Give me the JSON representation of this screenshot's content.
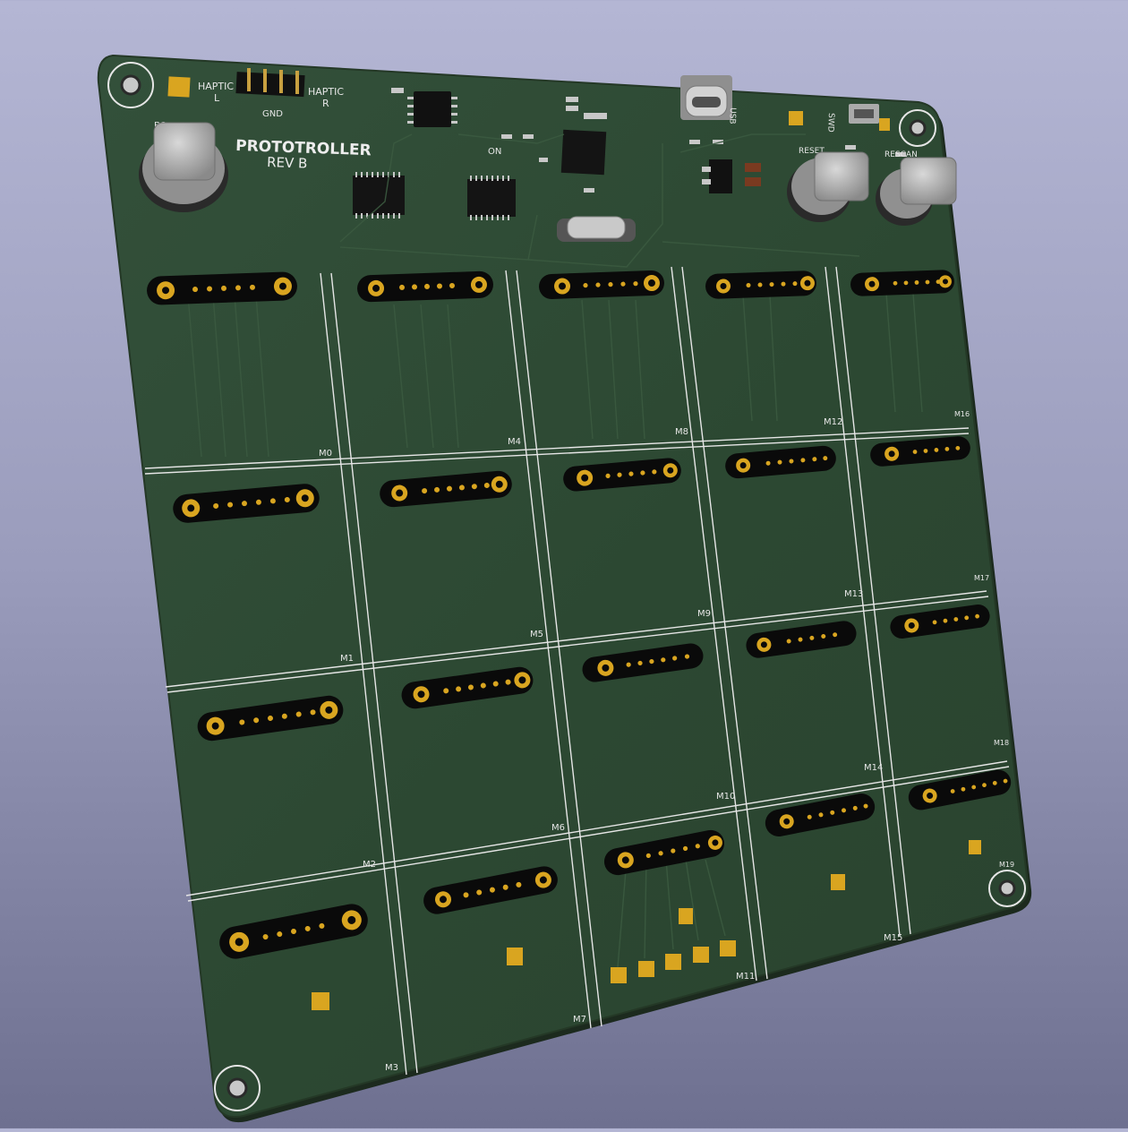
{
  "board": {
    "title": "PROTOTROLLER",
    "revision": "REV B",
    "colors": {
      "background_top": "#b4b6d4",
      "background_bottom": "#6e7090",
      "soldermask": "#2f4a31",
      "silkscreen": "#e6e6e6",
      "copper_pad": "#d9a520",
      "connector_body": "#0a0a0a"
    }
  },
  "labels": {
    "haptic_l_line1": "HAPTIC",
    "haptic_l_line2": "L",
    "gnd": "GND",
    "haptic_r_line1": "HAPTIC",
    "haptic_r_line2": "R",
    "boot": "BO",
    "on": "ON",
    "reset": "RESET",
    "rescan": "RESCAN",
    "usb": "USB",
    "swd": "SWD"
  },
  "modules": [
    "M0",
    "M1",
    "M2",
    "M3",
    "M4",
    "M5",
    "M6",
    "M7",
    "M8",
    "M9",
    "M10",
    "M11",
    "M12",
    "M13",
    "M14",
    "M15",
    "M16",
    "M17",
    "M18",
    "M19"
  ]
}
